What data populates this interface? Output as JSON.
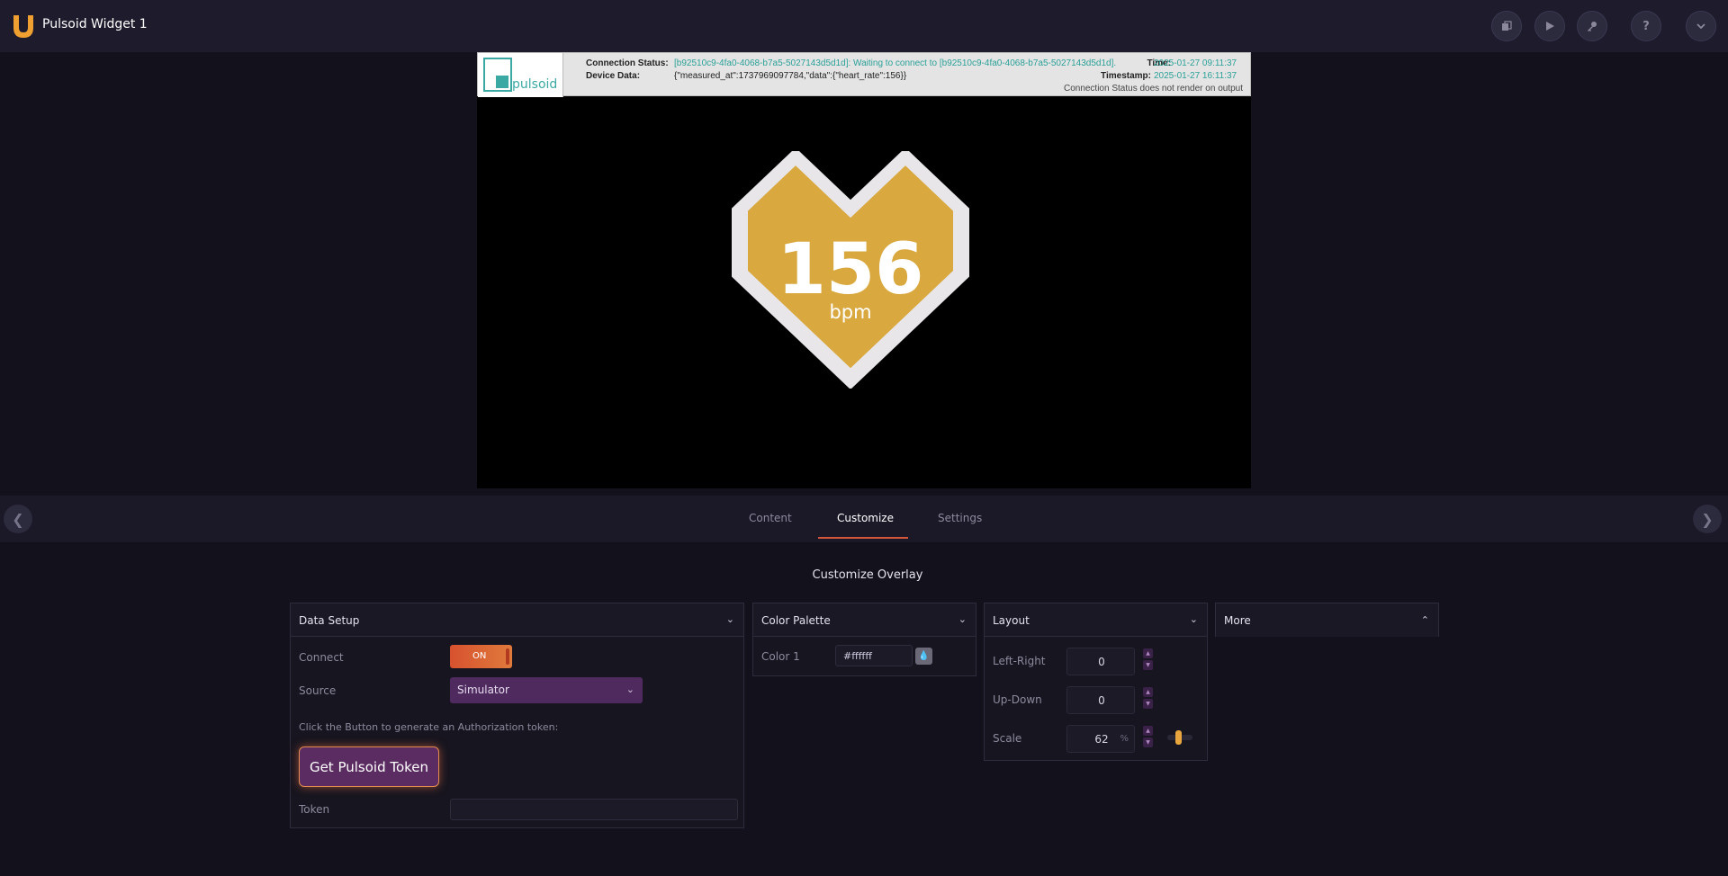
{
  "header": {
    "title": "Pulsoid Widget 1",
    "icons": [
      "copy-icon",
      "play-icon",
      "key-icon",
      "help-icon",
      "chevron-down-icon"
    ],
    "accent_color": "#f0a030"
  },
  "preview": {
    "logo_text": "pulsoid",
    "connection_status_label": "Connection Status:",
    "connection_status_value": "[b92510c9-4fa0-4068-b7a5-5027143d5d1d]: Waiting to connect to [b92510c9-4fa0-4068-b7a5-5027143d5d1d].",
    "device_data_label": "Device Data:",
    "device_data_value": "{\"measured_at\":1737969097784,\"data\":{\"heart_rate\":156}}",
    "time_label": "Time:",
    "time_value": "2025-01-27 09:11:37",
    "timestamp_label": "Timestamp:",
    "timestamp_value": "2025-01-27 16:11:37",
    "note": "Connection Status does not render on output",
    "heart_rate": "156",
    "unit": "bpm",
    "heart_color": "#d9a83e"
  },
  "tabs": {
    "items": [
      {
        "label": "Content"
      },
      {
        "label": "Customize"
      },
      {
        "label": "Settings"
      }
    ],
    "active": "Customize"
  },
  "customize": {
    "title": "Customize Overlay",
    "data_setup": {
      "title": "Data Setup",
      "connect_label": "Connect",
      "connect_value": "ON",
      "source_label": "Source",
      "source_value": "Simulator",
      "instruction": "Click the Button to generate an Authorization token:",
      "token_button": "Get Pulsoid Token",
      "token_label": "Token",
      "token_value": ""
    },
    "color_palette": {
      "title": "Color Palette",
      "color1_label": "Color 1",
      "color1_value": "#ffffff"
    },
    "layout": {
      "title": "Layout",
      "left_right_label": "Left-Right",
      "left_right_value": "0",
      "up_down_label": "Up-Down",
      "up_down_value": "0",
      "scale_label": "Scale",
      "scale_value": "62",
      "scale_unit": "%"
    },
    "more": {
      "title": "More"
    }
  }
}
